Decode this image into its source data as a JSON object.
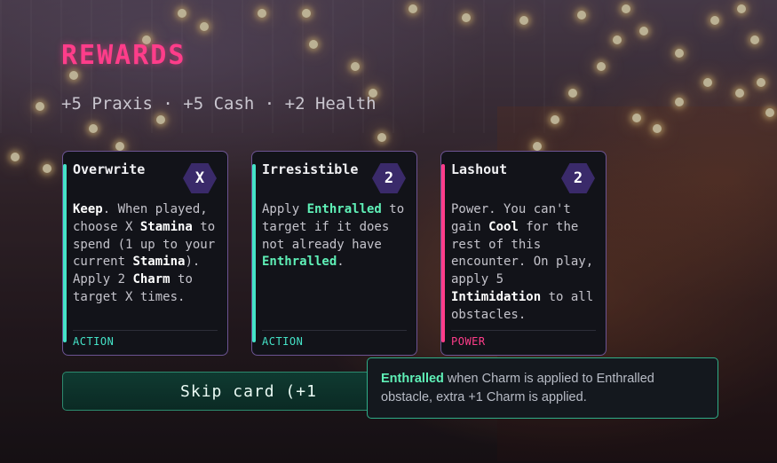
{
  "screen": {
    "title": "REWARDS",
    "rewards_summary": "+5 Praxis · +5 Cash · +2 Health"
  },
  "colors": {
    "title": "#ff3d8a",
    "action_stripe": "#44e2c7",
    "power_stripe": "#ff3d8a",
    "keyword_green": "#5ff0b7",
    "card_border": "#6b5391",
    "button_bg": "#0f3a31"
  },
  "cards": [
    {
      "name": "Overwrite",
      "cost": "X",
      "type": "ACTION",
      "text": [
        {
          "t": "Keep",
          "k": "white"
        },
        {
          "t": ". When played, choose X "
        },
        {
          "t": "Stamina",
          "k": "white"
        },
        {
          "t": " to spend (1 up to your current "
        },
        {
          "t": "Stamina",
          "k": "white"
        },
        {
          "t": "). Apply 2 "
        },
        {
          "t": "Charm",
          "k": "white"
        },
        {
          "t": " to target X times."
        }
      ]
    },
    {
      "name": "Irresistible",
      "cost": "2",
      "type": "ACTION",
      "text": [
        {
          "t": "Apply "
        },
        {
          "t": "Enthralled",
          "k": "green"
        },
        {
          "t": " to target if it does not already have "
        },
        {
          "t": "Enthralled",
          "k": "green"
        },
        {
          "t": "."
        }
      ]
    },
    {
      "name": "Lashout",
      "cost": "2",
      "type": "POWER",
      "text": [
        {
          "t": "Power. You can't gain "
        },
        {
          "t": "Cool",
          "k": "white"
        },
        {
          "t": " for the rest of this encounter. On play, apply 5 "
        },
        {
          "t": "Intimidation",
          "k": "white"
        },
        {
          "t": " to all obstacles."
        }
      ]
    }
  ],
  "skip_button": {
    "label": "Skip card (+1"
  },
  "tooltip": {
    "keyword": "Enthralled",
    "description": " when Charm is applied to Enthralled obstacle, extra +1 Charm is applied."
  }
}
